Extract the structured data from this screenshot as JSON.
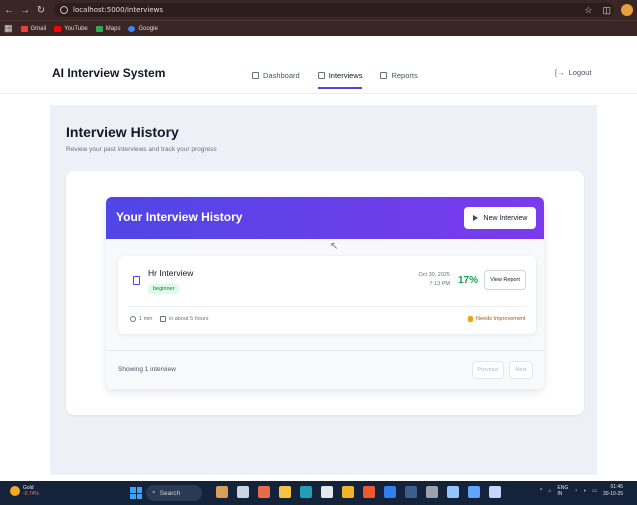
{
  "browser": {
    "url": "localhost:5000/interviews",
    "bookmarks": [
      {
        "label": "Gmail",
        "color": "#ea4335"
      },
      {
        "label": "YouTube",
        "color": "#ff0000"
      },
      {
        "label": "Maps",
        "color": "#34a853"
      },
      {
        "label": "Google",
        "color": "#4285f4"
      }
    ]
  },
  "header": {
    "brand": "AI Interview System",
    "nav": [
      {
        "label": "Dashboard"
      },
      {
        "label": "Interviews"
      },
      {
        "label": "Reports"
      }
    ],
    "logout": "Logout"
  },
  "page": {
    "title": "Interview History",
    "subtitle": "Review your past interviews and track your progress"
  },
  "history": {
    "title": "Your Interview History",
    "new_button": "New Interview",
    "items": [
      {
        "name": "Hr Interview",
        "level": "beginner",
        "date": "Oct 30, 2025",
        "time": "7:13 PM",
        "score": "17%",
        "report_button": "View Report",
        "duration": "1 min",
        "relative": "in about 5 hours",
        "status": "Needs Improvement"
      }
    ],
    "footer": {
      "showing": "Showing 1 interview",
      "previous": "Previous",
      "next": "Next"
    }
  },
  "taskbar": {
    "weather_label": "Gold",
    "weather_change": "-0.74%",
    "search": "Search",
    "lang_top": "ENG",
    "lang_bottom": "IN",
    "time": "01:45",
    "date": "30-10-25"
  },
  "colors": {
    "accent": "#4f46e5",
    "gradient_end": "#7c3aed",
    "score": "#16a34a",
    "badge_bg": "#dcfce7"
  }
}
